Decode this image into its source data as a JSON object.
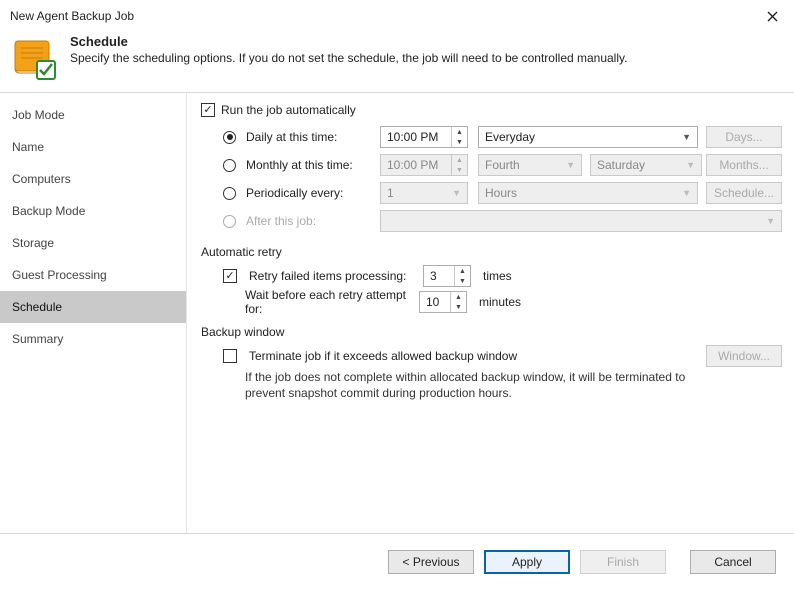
{
  "window": {
    "title": "New Agent Backup Job"
  },
  "header": {
    "title": "Schedule",
    "desc": "Specify the scheduling options. If you do not set the schedule, the job will need to be controlled manually."
  },
  "sidebar": {
    "items": [
      {
        "label": "Job Mode"
      },
      {
        "label": "Name"
      },
      {
        "label": "Computers"
      },
      {
        "label": "Backup Mode"
      },
      {
        "label": "Storage"
      },
      {
        "label": "Guest Processing"
      },
      {
        "label": "Schedule"
      },
      {
        "label": "Summary"
      }
    ],
    "selectedIndex": 6
  },
  "runAuto": {
    "label": "Run the job automatically",
    "checked": true,
    "daily": {
      "label": "Daily at this time:",
      "time": "10:00 PM",
      "freq": "Everyday",
      "btn": "Days..."
    },
    "monthly": {
      "label": "Monthly at this time:",
      "time": "10:00 PM",
      "ord": "Fourth",
      "dow": "Saturday",
      "btn": "Months..."
    },
    "period": {
      "label": "Periodically every:",
      "num": "1",
      "unit": "Hours",
      "btn": "Schedule..."
    },
    "after": {
      "label": "After this job:"
    }
  },
  "retry": {
    "section": "Automatic retry",
    "enable": {
      "label": "Retry failed items processing:",
      "checked": true,
      "times": "3",
      "unit": "times"
    },
    "wait": {
      "label": "Wait before each retry attempt for:",
      "mins": "10",
      "unit": "minutes"
    }
  },
  "bw": {
    "section": "Backup window",
    "terminate": {
      "label": "Terminate job if it exceeds allowed backup window",
      "checked": false,
      "btn": "Window..."
    },
    "desc": "If the job does not complete within allocated backup window, it will be terminated to prevent snapshot commit during production hours."
  },
  "footer": {
    "previous": "<  Previous",
    "apply": "Apply",
    "finish": "Finish",
    "cancel": "Cancel"
  }
}
